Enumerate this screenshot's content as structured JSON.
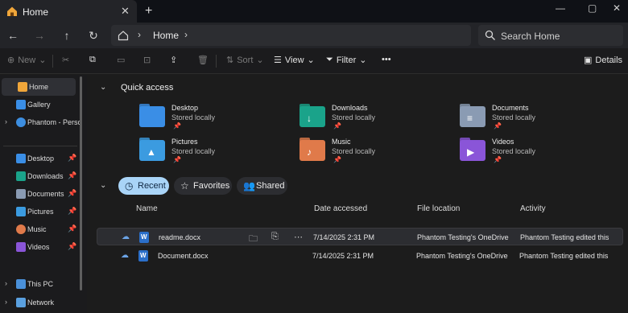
{
  "tab": {
    "title": "Home",
    "close": "✕",
    "new_tab": "+"
  },
  "window": {
    "minimize": "—",
    "maximize": "▢",
    "close": "✕"
  },
  "address": {
    "crumb": "Home",
    "search_placeholder": "Search Home"
  },
  "commands": {
    "new": "New",
    "sort": "Sort",
    "view": "View",
    "filter": "Filter",
    "more": "•••",
    "details": "Details"
  },
  "sidebar": {
    "items": [
      {
        "label": "Home"
      },
      {
        "label": "Gallery"
      },
      {
        "label": "Phantom - Perso"
      },
      {
        "label": "Desktop"
      },
      {
        "label": "Downloads"
      },
      {
        "label": "Documents"
      },
      {
        "label": "Pictures"
      },
      {
        "label": "Music"
      },
      {
        "label": "Videos"
      },
      {
        "label": "This PC"
      },
      {
        "label": "Network"
      }
    ]
  },
  "quick_access": {
    "title": "Quick access",
    "items": [
      {
        "name": "Desktop",
        "sub": "Stored locally",
        "color": "#3a8ee6"
      },
      {
        "name": "Downloads",
        "sub": "Stored locally",
        "color": "#1aa38a"
      },
      {
        "name": "Documents",
        "sub": "Stored locally",
        "color": "#8a9bb3"
      },
      {
        "name": "Pictures",
        "sub": "Stored locally",
        "color": "#3b9be0"
      },
      {
        "name": "Music",
        "sub": "Stored locally",
        "color": "#e07a4a"
      },
      {
        "name": "Videos",
        "sub": "Stored locally",
        "color": "#8a55d8"
      }
    ]
  },
  "filters": {
    "recent": "Recent",
    "favorites": "Favorites",
    "shared": "Shared"
  },
  "columns": {
    "name": "Name",
    "date": "Date accessed",
    "location": "File location",
    "activity": "Activity"
  },
  "files": [
    {
      "name": "readme.docx",
      "date": "7/14/2025 2:31 PM",
      "location": "Phantom Testing's OneDrive",
      "activity": "Phantom Testing edited this"
    },
    {
      "name": "Document.docx",
      "date": "7/14/2025 2:31 PM",
      "location": "Phantom Testing's OneDrive",
      "activity": "Phantom Testing edited this"
    }
  ]
}
